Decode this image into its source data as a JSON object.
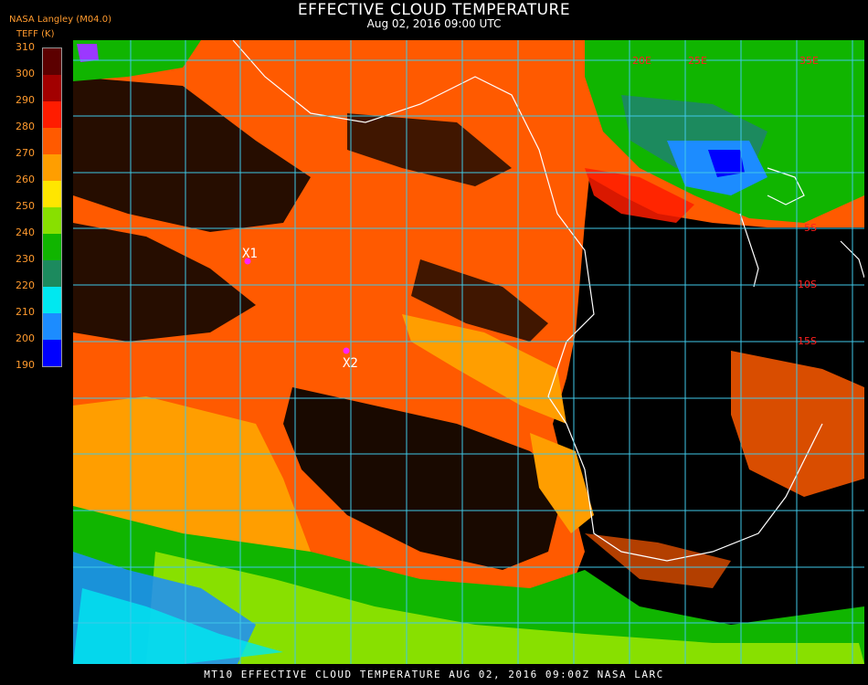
{
  "header": {
    "title": "EFFECTIVE CLOUD TEMPERATURE",
    "subtitle": "Aug 02, 2016 09:00 UTC",
    "source": "NASA Langley (M04.0)",
    "unit": "TEFF (K)"
  },
  "colorbar": {
    "ticks": [
      "310",
      "300",
      "290",
      "280",
      "270",
      "260",
      "250",
      "240",
      "230",
      "220",
      "210",
      "200",
      "190"
    ],
    "colors": [
      "#5c0000",
      "#a20000",
      "#ff1c00",
      "#ff5a00",
      "#ff9e00",
      "#ffe600",
      "#88e000",
      "#10b500",
      "#1c8a5e",
      "#00e8f0",
      "#1c8cff",
      "#0000ff",
      "#9b38ff"
    ]
  },
  "map": {
    "grid_labels": [
      {
        "text": "20E"
      },
      {
        "text": "25E"
      },
      {
        "text": "35E"
      },
      {
        "text": "5S"
      },
      {
        "text": "10S"
      },
      {
        "text": "15S"
      }
    ],
    "markers": [
      {
        "text": "X1"
      },
      {
        "text": "X2"
      }
    ],
    "colors": {
      "grid": "#3fc8e8",
      "coast": "#ffffff",
      "marker": "#ff22ff",
      "label": "#ff2020"
    }
  },
  "footer": {
    "text": "MT10  EFFECTIVE CLOUD TEMPERATURE   AUG 02, 2016 09:00Z   NASA LARC"
  }
}
